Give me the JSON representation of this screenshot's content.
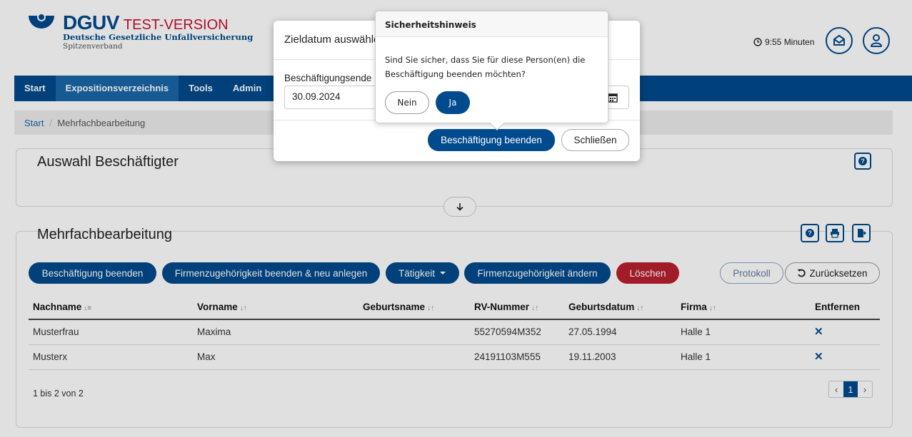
{
  "header": {
    "logo_name": "DGUV",
    "logo_suffix": "TEST-VERSION",
    "logo_line2": "Deutsche Gesetzliche Unfallversicherung",
    "logo_line3": "Spitzenverband",
    "session_timer": "9:55 Minuten",
    "icons": {
      "timer": "clock-icon",
      "mail": "mail-icon",
      "user": "user-icon"
    }
  },
  "nav": {
    "items": [
      {
        "label": "Start"
      },
      {
        "label": "Expositionsverzeichnis",
        "active": true
      },
      {
        "label": "Tools"
      },
      {
        "label": "Admin"
      }
    ]
  },
  "breadcrumb": {
    "home": "Start",
    "separator": "/",
    "current": "Mehrfachbearbeitung"
  },
  "auswahl_panel": {
    "title": "Auswahl Beschäftigter",
    "expand_icon": "arrow-down-icon"
  },
  "mehrfach_panel": {
    "title": "Mehrfachbearbeitung",
    "actions": {
      "beenden": "Beschäftigung beenden",
      "firmenzugehoerigkeit_neu": "Firmenzugehörigkeit beenden & neu anlegen",
      "taetigkeit": "Tätigkeit",
      "firmenzugehoerigkeit_aendern": "Firmenzugehörigkeit ändern",
      "loeschen": "Löschen",
      "protokoll": "Protokoll",
      "zuruecksetzen": "Zurücksetzen"
    },
    "columns": [
      "Nachname",
      "Vorname",
      "Geburtsname",
      "RV-Nummer",
      "Geburtsdatum",
      "Firma",
      "Entfernen"
    ],
    "rows": [
      {
        "nachname": "Musterfrau",
        "vorname": "Maxima",
        "geburtsname": "",
        "rv": "55270594M352",
        "geburtsdatum": "27.05.1994",
        "firma": "Halle 1"
      },
      {
        "nachname": "Musterx",
        "vorname": "Max",
        "geburtsname": "",
        "rv": "24191103M555",
        "geburtsdatum": "19.11.2003",
        "firma": "Halle 1"
      }
    ],
    "footer_count": "1 bis 2 von 2",
    "pagination": {
      "prev": "‹",
      "current": "1",
      "next": "›"
    }
  },
  "modal": {
    "title": "Zieldatum auswählen",
    "field_label": "Beschäftigungsende",
    "field_value": "30.09.2024",
    "confirm_button": "Beschäftigung beenden",
    "close_button": "Schließen"
  },
  "popover": {
    "title": "Sicherheitshinweis",
    "message_line1": "Sind Sie sicher, dass Sie für diese Person(en) die",
    "message_line2": "Beschäftigung beenden möchten?",
    "no": "Nein",
    "yes": "Ja"
  },
  "colors": {
    "brand": "#004b8d",
    "danger": "#b8202e",
    "test_label": "#c8102e"
  }
}
